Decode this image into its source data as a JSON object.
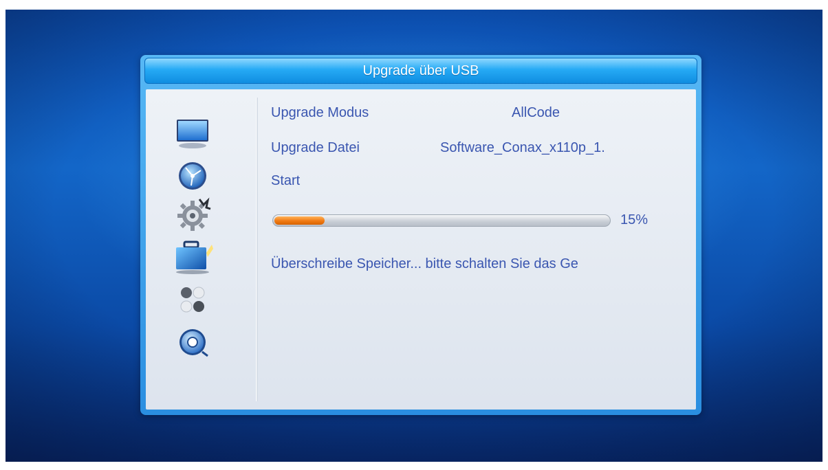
{
  "dialog": {
    "title": "Upgrade über USB"
  },
  "sidebar": {
    "items": [
      {
        "icon": "tv-icon"
      },
      {
        "icon": "satellite-dish-icon"
      },
      {
        "icon": "gear-icon"
      },
      {
        "icon": "toolbox-icon",
        "selected": true
      },
      {
        "icon": "games-icon"
      },
      {
        "icon": "media-player-icon"
      }
    ]
  },
  "settings": {
    "mode_label": "Upgrade Modus",
    "mode_value": "AllCode",
    "file_label": "Upgrade Datei",
    "file_value": "Software_Conax_x110p_1.",
    "start_label": "Start"
  },
  "progress": {
    "percent": 15,
    "percent_label": "15%",
    "status": "Überschreibe Speicher... bitte schalten Sie das Ge"
  },
  "colors": {
    "accent_blue": "#26aaf5",
    "text_blue": "#3a56b0",
    "progress_orange": "#f07a12"
  }
}
